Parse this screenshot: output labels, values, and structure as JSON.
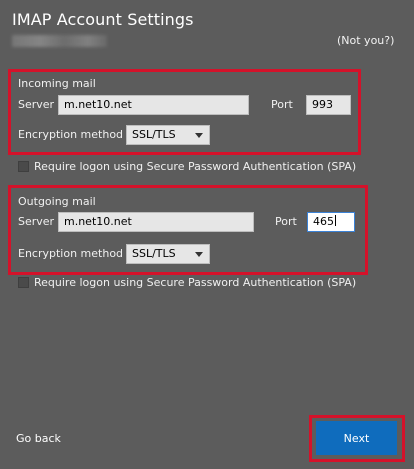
{
  "header": {
    "title": "IMAP Account Settings",
    "not_you": "(Not you?)"
  },
  "incoming": {
    "section_label": "Incoming mail",
    "server_label": "Server",
    "server_value": "m.net10.net",
    "port_label": "Port",
    "port_value": "993",
    "encryption_label": "Encryption method",
    "encryption_value": "SSL/TLS",
    "spa_label": "Require logon using Secure Password Authentication (SPA)",
    "spa_checked": false
  },
  "outgoing": {
    "section_label": "Outgoing mail",
    "server_label": "Server",
    "server_value": "m.net10.net",
    "port_label": "Port",
    "port_value": "465",
    "encryption_label": "Encryption method",
    "encryption_value": "SSL/TLS",
    "spa_label": "Require logon using Secure Password Authentication (SPA)",
    "spa_checked": false
  },
  "footer": {
    "go_back": "Go back",
    "next": "Next"
  },
  "colors": {
    "background": "#5c5c5c",
    "highlight_border": "#d4122a",
    "primary_button": "#0f6cbd",
    "focus_border": "#3b82d6"
  }
}
